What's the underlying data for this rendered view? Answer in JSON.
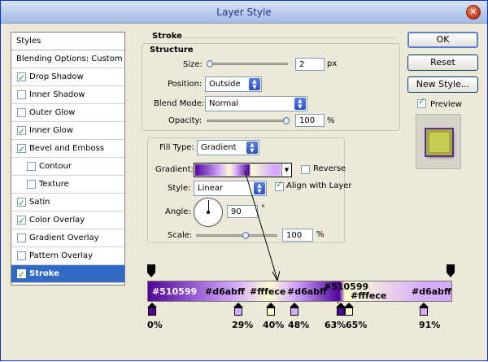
{
  "window": {
    "title": "Layer Style"
  },
  "styles": {
    "header": "Styles",
    "items": [
      {
        "label": "Blending Options: Custom",
        "checkbox": false,
        "checked": false,
        "sub": false,
        "active": false
      },
      {
        "label": "Drop Shadow",
        "checkbox": true,
        "checked": true,
        "sub": false,
        "active": false
      },
      {
        "label": "Inner Shadow",
        "checkbox": true,
        "checked": false,
        "sub": false,
        "active": false
      },
      {
        "label": "Outer Glow",
        "checkbox": true,
        "checked": false,
        "sub": false,
        "active": false
      },
      {
        "label": "Inner Glow",
        "checkbox": true,
        "checked": true,
        "sub": false,
        "active": false
      },
      {
        "label": "Bevel and Emboss",
        "checkbox": true,
        "checked": true,
        "sub": false,
        "active": false
      },
      {
        "label": "Contour",
        "checkbox": true,
        "checked": false,
        "sub": true,
        "active": false
      },
      {
        "label": "Texture",
        "checkbox": true,
        "checked": false,
        "sub": true,
        "active": false
      },
      {
        "label": "Satin",
        "checkbox": true,
        "checked": true,
        "sub": false,
        "active": false
      },
      {
        "label": "Color Overlay",
        "checkbox": true,
        "checked": true,
        "sub": false,
        "active": false
      },
      {
        "label": "Gradient Overlay",
        "checkbox": true,
        "checked": false,
        "sub": false,
        "active": false
      },
      {
        "label": "Pattern Overlay",
        "checkbox": true,
        "checked": false,
        "sub": false,
        "active": false
      },
      {
        "label": "Stroke",
        "checkbox": true,
        "checked": true,
        "sub": false,
        "active": true
      }
    ]
  },
  "stroke": {
    "title": "Stroke",
    "structure_title": "Structure",
    "size_label": "Size:",
    "size_value": "2",
    "size_unit": "px",
    "position_label": "Position:",
    "position_value": "Outside",
    "blend_label": "Blend Mode:",
    "blend_value": "Normal",
    "opacity_label": "Opacity:",
    "opacity_value": "100",
    "opacity_unit": "%",
    "fill_type_label": "Fill Type:",
    "fill_type_value": "Gradient",
    "gradient_label": "Gradient:",
    "reverse_label": "Reverse",
    "style_label": "Style:",
    "style_value": "Linear",
    "align_label": "Align with Layer",
    "angle_label": "Angle:",
    "angle_value": "90",
    "angle_unit": "°",
    "scale_label": "Scale:",
    "scale_value": "100",
    "scale_unit": "%"
  },
  "buttons": {
    "ok": "OK",
    "reset": "Reset",
    "new_style": "New Style...",
    "preview": "Preview"
  },
  "gradient_stops": {
    "labels_top": [
      "#510599",
      "#d6abff",
      "#fffece",
      "#d6abff",
      "#510599",
      "#fffece",
      "#d6abff"
    ],
    "percents": [
      "0%",
      "29%",
      "40%",
      "48%",
      "63%",
      "65%",
      "91%"
    ],
    "colors": [
      "#510599",
      "#d6abff",
      "#fffece",
      "#d6abff",
      "#510599",
      "#fffece",
      "#d6abff"
    ]
  }
}
